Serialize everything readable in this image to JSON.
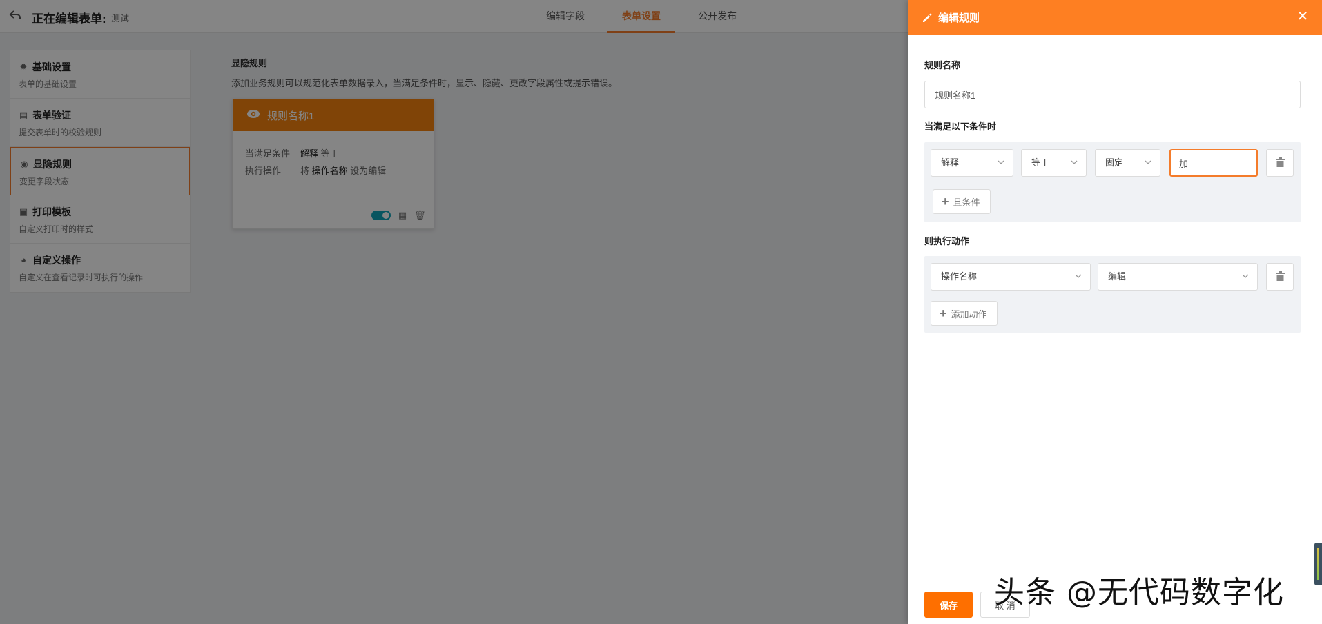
{
  "header": {
    "editing_label": "正在编辑表单:",
    "form_name": "测试",
    "tabs": [
      {
        "label": "编辑字段",
        "active": false
      },
      {
        "label": "表单设置",
        "active": true
      },
      {
        "label": "公开发布",
        "active": false
      }
    ]
  },
  "sidebar": {
    "items": [
      {
        "title": "基础设置",
        "subtitle": "表单的基础设置",
        "icon": "gear-icon",
        "active": false
      },
      {
        "title": "表单验证",
        "subtitle": "提交表单时的校验规则",
        "icon": "clipboard-icon",
        "active": false
      },
      {
        "title": "显隐规则",
        "subtitle": "变更字段状态",
        "icon": "eye-icon",
        "active": true
      },
      {
        "title": "打印模板",
        "subtitle": "自定义打印时的样式",
        "icon": "printer-icon",
        "active": false
      },
      {
        "title": "自定义操作",
        "subtitle": "自定义在查看记录时可执行的操作",
        "icon": "palette-icon",
        "active": false
      }
    ]
  },
  "main": {
    "title": "显隐规则",
    "description": "添加业务规则可以规范化表单数据录入，当满足条件时，显示、隐藏、更改字段属性或提示错误。",
    "rule_card": {
      "name": "规则名称1",
      "condition_label": "当满足条件",
      "condition_field": "解释",
      "condition_op": "等于",
      "action_label": "执行操作",
      "action_prefix": "将",
      "action_field": "操作名称",
      "action_suffix": "设为编辑",
      "enabled": true
    }
  },
  "drawer": {
    "title": "编辑规则",
    "rule_name_label": "规则名称",
    "rule_name_value": "规则名称1",
    "conditions_label": "当满足以下条件时",
    "condition": {
      "field": "解释",
      "operator": "等于",
      "value_type": "固定",
      "value": "加"
    },
    "add_condition_label": "且条件",
    "actions_label": "则执行动作",
    "action": {
      "target": "操作名称",
      "state": "编辑"
    },
    "add_action_label": "添加动作",
    "save_label": "保存",
    "cancel_label": "取 消"
  },
  "watermark": "头条 @无代码数字化",
  "colors": {
    "accent": "#f47c2b",
    "drawer_header": "#fe7f22",
    "card_header": "#f6820f",
    "toggle_on": "#0fa3b8"
  }
}
